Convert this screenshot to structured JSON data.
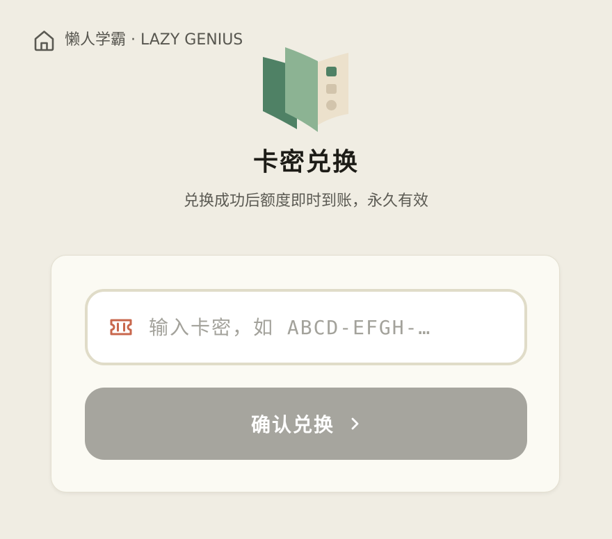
{
  "header": {
    "home_icon": "home-icon",
    "brand": "懒人学霸 · LAZY GENIUS"
  },
  "hero": {
    "logo_icon": "open-book-icon",
    "title": "卡密兑换",
    "subtitle": "兑换成功后额度即时到账，永久有效"
  },
  "form": {
    "input_icon": "ticket-icon",
    "code_value": "",
    "code_placeholder": "输入卡密，如 ABCD-EFGH-…",
    "submit_label": "确认兑换",
    "submit_icon": "chevron-right-icon"
  },
  "colors": {
    "background": "#f0ede3",
    "card": "#fbfaf3",
    "accent_green": "#4f8165",
    "accent_green_light": "#8cb393",
    "ticket_red": "#c8674c",
    "button_disabled": "#a6a59e"
  }
}
